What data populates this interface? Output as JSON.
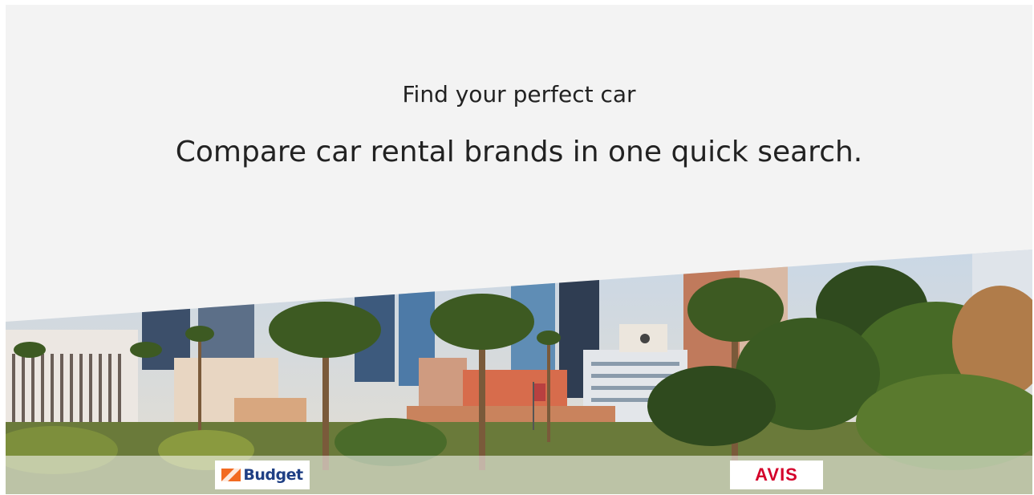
{
  "hero": {
    "subtitle": "Find your perfect car",
    "headline": "Compare car rental brands in one quick search."
  },
  "image": {
    "icon": "city-skyline-palm-trees-photo"
  },
  "brands": [
    {
      "label": "Budget",
      "icon": "budget-logo",
      "color": "#1f3f84",
      "accent": "#f26a21"
    },
    {
      "label": "AVIS",
      "icon": "avis-logo",
      "color": "#d4002a"
    }
  ],
  "colors": {
    "background": "#f3f3f3",
    "text": "#222222"
  }
}
